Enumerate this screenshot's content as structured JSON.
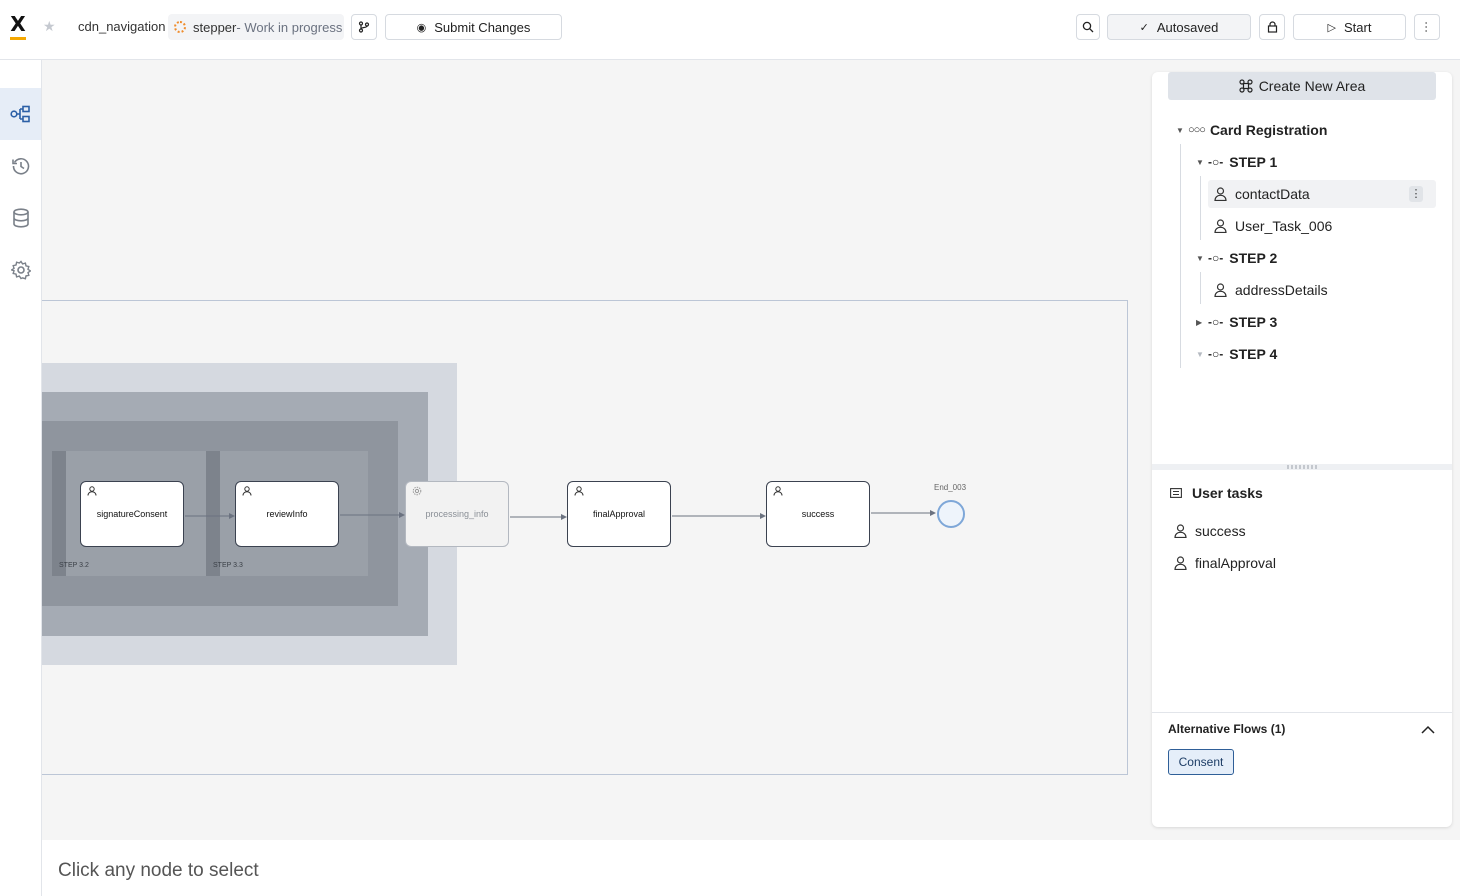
{
  "header": {
    "project_name": "cdn_navigation",
    "process_name": "stepper",
    "process_status": "- Work in progress",
    "submit_label": "Submit Changes",
    "autosave_label": "Autosaved",
    "start_label": "Start"
  },
  "nav": {
    "items": [
      "process-designer",
      "history",
      "data-model",
      "settings"
    ],
    "active": "process-designer"
  },
  "canvas": {
    "step_labels": [
      "STEP 3.2",
      "STEP 3.3"
    ],
    "nodes": [
      {
        "label": "signatureConsent",
        "type": "user"
      },
      {
        "label": "reviewInfo",
        "type": "user"
      },
      {
        "label": "processing_info",
        "type": "service"
      },
      {
        "label": "finalApproval",
        "type": "user"
      },
      {
        "label": "success",
        "type": "user"
      }
    ],
    "end_label": "End_003",
    "hint": "Click any node to select"
  },
  "panel": {
    "create_area_label": "Create New Area",
    "root": "Card Registration",
    "steps": [
      {
        "label": "STEP 1",
        "expanded": true,
        "tasks": [
          "contactData",
          "User_Task_006"
        ]
      },
      {
        "label": "STEP 2",
        "expanded": true,
        "tasks": [
          "addressDetails"
        ]
      },
      {
        "label": "STEP 3",
        "expanded": false,
        "tasks": []
      },
      {
        "label": "STEP 4",
        "expanded": true,
        "tasks": []
      }
    ],
    "user_tasks_title": "User tasks",
    "user_tasks": [
      "success",
      "finalApproval"
    ],
    "alt_flows_title": "Alternative Flows (1)",
    "alt_flows": [
      "Consent"
    ]
  },
  "colors": {
    "accent": "#f5a800",
    "end_event": "#7ea7d8",
    "wip": "#f08c2b"
  }
}
